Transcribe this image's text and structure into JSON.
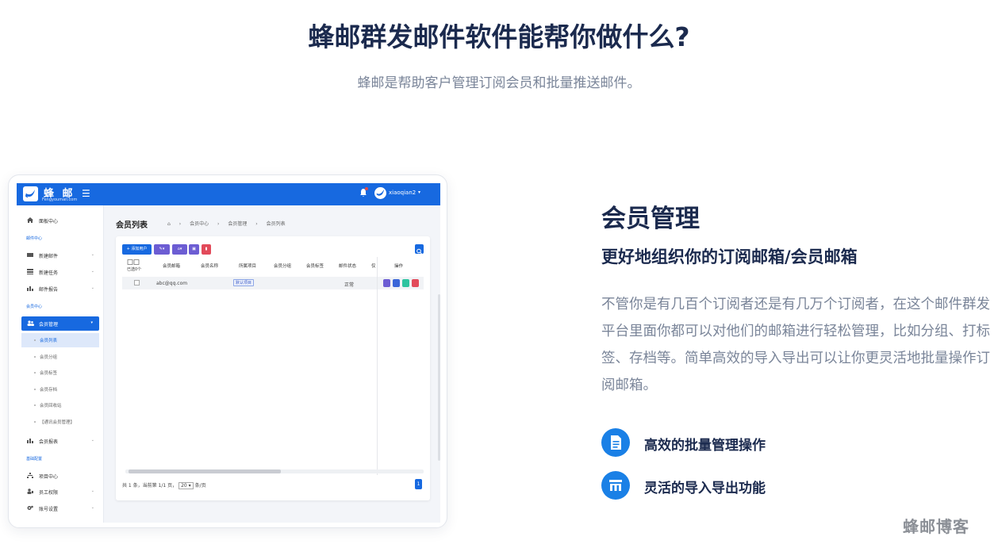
{
  "hero": {
    "title": "蜂邮群发邮件软件能帮你做什么?",
    "subtitle": "蜂邮是帮助客户管理订阅会员和批量推送邮件。"
  },
  "app": {
    "brand": "蜂 邮",
    "brand_sub": "Fengyoumail.com",
    "user": "xiaoqian2",
    "sidebar": {
      "home": "面板中心",
      "section_mail": "邮件中心",
      "new_mail": "新建邮件",
      "new_task": "新建任务",
      "mail_report": "邮件报告",
      "section_member": "会员中心",
      "member_manage": "会员管理",
      "sub_items": [
        "会员列表",
        "会员分组",
        "会员标签",
        "会员存档",
        "会员回收站",
        "【通讯会员管理】"
      ],
      "member_report": "会员报表",
      "section_base": "基础配置",
      "project_center": "项目中心",
      "staff_permission": "员工权限",
      "account_settings": "账号设置"
    },
    "breadcrumb": {
      "title": "会员列表",
      "items": [
        "会员中心",
        "会员管理",
        "会员列表"
      ]
    },
    "toolbar": {
      "add_user": "+ 添加用户"
    },
    "table": {
      "select_all": "已选0个",
      "headers": [
        "会员邮箱",
        "会员名称",
        "所属项目",
        "会员分组",
        "会员标签",
        "邮件状态",
        "仅",
        "操作"
      ],
      "rows": [
        {
          "email": "abc@qq.com",
          "project": "默认项目",
          "status": "正常"
        }
      ]
    },
    "pager": {
      "summary": "共 1 条，当前第 1/1 页，",
      "page_size": "20",
      "per_page": "条/页",
      "current_page": "1"
    }
  },
  "feature": {
    "title": "会员管理",
    "subtitle": "更好地组织你的订阅邮箱/会员邮箱",
    "description": "不管你是有几百个订阅者还是有几万个订阅者，在这个邮件群发平台里面你都可以对他们的邮箱进行轻松管理，比如分组、打标签、存档等。简单高效的导入导出可以让你更灵活地批量操作订阅邮箱。",
    "items": [
      {
        "label": "高效的批量管理操作",
        "icon": "document-icon"
      },
      {
        "label": "灵活的导入导出功能",
        "icon": "import-export-icon"
      }
    ]
  },
  "watermark": "蜂邮博客",
  "colors": {
    "brand_blue": "#1769e0",
    "title_navy": "#1b2a4e",
    "text_gray": "#7a8599"
  }
}
